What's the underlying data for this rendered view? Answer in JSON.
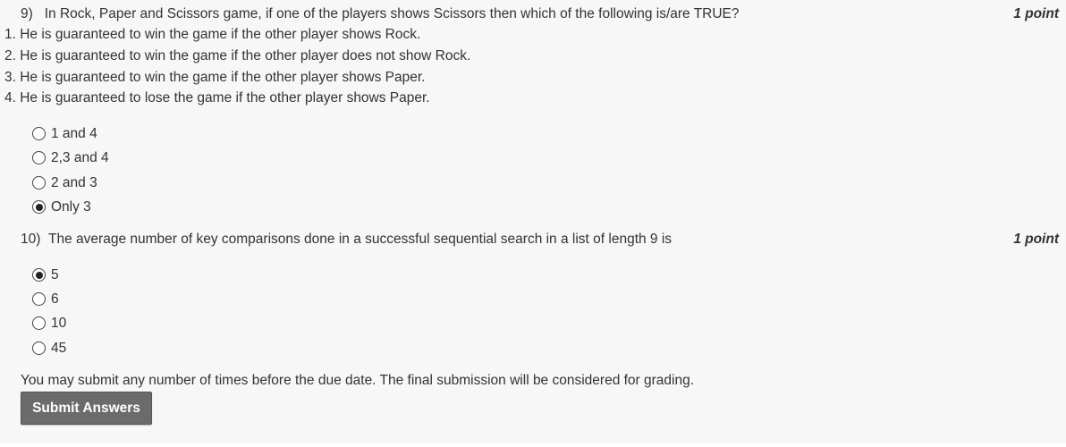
{
  "questions": [
    {
      "number": "9)",
      "text": "In Rock, Paper and Scissors game, if one of the players shows Scissors then which of the following is/are TRUE?",
      "points": "1 point",
      "statements": [
        "1. He is guaranteed to win the game if the other player shows Rock.",
        "2. He is guaranteed to win the game if the other player does not show Rock.",
        "3. He is guaranteed to win the game if the other player shows Paper.",
        "4. He is guaranteed to lose the game if the other player shows Paper."
      ],
      "options": [
        {
          "label": "1 and 4",
          "selected": false
        },
        {
          "label": "2,3 and 4",
          "selected": false
        },
        {
          "label": "2 and 3",
          "selected": false
        },
        {
          "label": "Only 3",
          "selected": true
        }
      ]
    },
    {
      "number": "10)",
      "text": "The average number of key comparisons done in a successful sequential search in a list of length 9 is",
      "points": "1 point",
      "options": [
        {
          "label": "5",
          "selected": true
        },
        {
          "label": "6",
          "selected": false
        },
        {
          "label": "10",
          "selected": false
        },
        {
          "label": "45",
          "selected": false
        }
      ]
    }
  ],
  "footer": {
    "note": "You may submit any number of times before the due date. The final submission will be considered for grading.",
    "submit_label": "Submit Answers"
  }
}
